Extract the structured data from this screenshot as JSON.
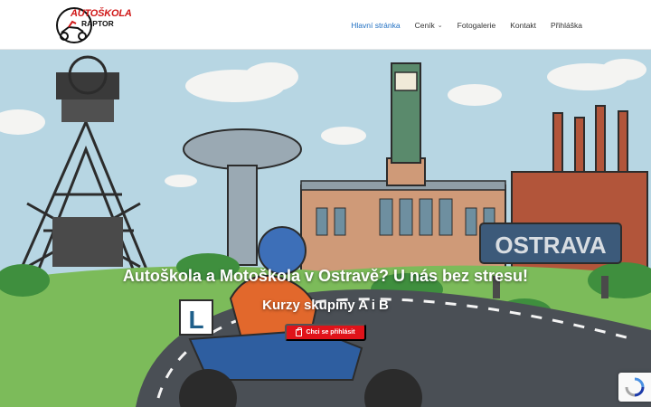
{
  "header": {
    "logo": {
      "line1": "AUTOŠKOLA",
      "line2": "RAPTOR"
    },
    "nav": [
      {
        "label": "Hlavní stránka",
        "active": true
      },
      {
        "label": "Ceník",
        "has_dropdown": true
      },
      {
        "label": "Fotogalerie"
      },
      {
        "label": "Kontakt"
      },
      {
        "label": "Přihláška"
      }
    ]
  },
  "hero": {
    "title": "Autoškola a Motoškola v Ostravě? U nás bez stresu!",
    "subtitle": "Kurzy skupiny A i B",
    "cta_label": "Chci se přihlásit",
    "cta_icon": "clipboard-icon",
    "sign_text": "OSTRAVA",
    "learner_plate": "L"
  },
  "colors": {
    "accent_blue": "#1f6fc2",
    "cta_red": "#e0131a",
    "logo_red": "#d01818",
    "sky": "#b9d7e3"
  },
  "widgets": {
    "recaptcha_icon": "recaptcha-icon"
  }
}
